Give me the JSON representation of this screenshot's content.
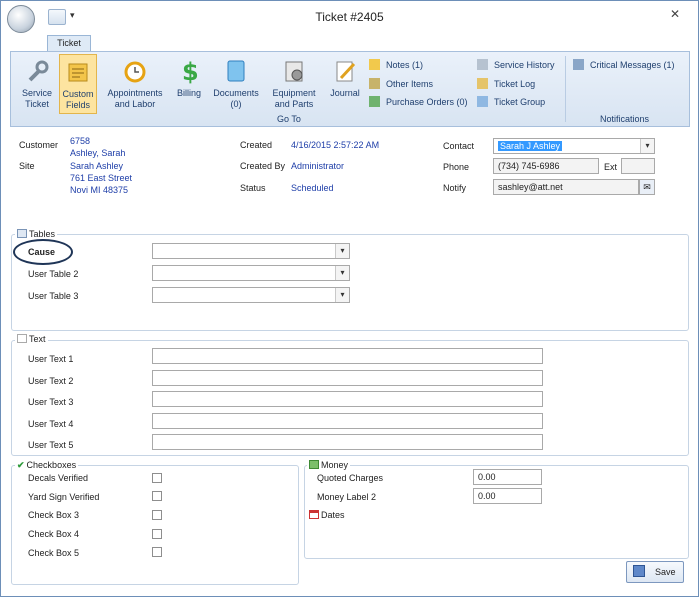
{
  "window": {
    "title": "Ticket #2405"
  },
  "tabs": [
    "Ticket"
  ],
  "ribbon": {
    "goto_buttons": [
      {
        "label1": "Service",
        "label2": "Ticket",
        "icon": "wrench-icon"
      },
      {
        "label1": "Custom",
        "label2": "Fields",
        "icon": "custom-fields-icon",
        "selected": true
      },
      {
        "label1": "Appointments",
        "label2": "and Labor",
        "icon": "alarm-clock-icon"
      },
      {
        "label1": "Billing",
        "label2": "",
        "icon": "dollar-icon"
      },
      {
        "label1": "Documents",
        "label2": "(0)",
        "icon": "document-icon"
      },
      {
        "label1": "Equipment",
        "label2": "and Parts",
        "icon": "equipment-icon"
      },
      {
        "label1": "Journal",
        "label2": "",
        "icon": "journal-icon"
      }
    ],
    "small_col1": [
      "Notes (1)",
      "Other Items",
      "Purchase Orders (0)"
    ],
    "small_col2": [
      "Service History",
      "Ticket Log",
      "Ticket Group"
    ],
    "goto_label": "Go To",
    "critical_messages": "Critical Messages (1)",
    "notifications_label": "Notifications"
  },
  "header": {
    "customer_label": "Customer",
    "customer_id": "6758",
    "customer_name": "Ashley, Sarah",
    "site_label": "Site",
    "site_name": "Sarah Ashley",
    "site_street": "761 East Street",
    "site_city": "Novi MI 48375",
    "created_label": "Created",
    "created_value": "4/16/2015 2:57:22 AM",
    "created_by_label": "Created By",
    "created_by_value": "Administrator",
    "status_label": "Status",
    "status_value": "Scheduled",
    "contact_label": "Contact",
    "contact_value": "Sarah J Ashley",
    "phone_label": "Phone",
    "phone_value": "(734) 745-6986",
    "ext_label": "Ext",
    "ext_value": "",
    "notify_label": "Notify",
    "notify_value": "sashley@att.net"
  },
  "tables": {
    "title": "Tables",
    "rows": [
      {
        "label": "Cause",
        "value": ""
      },
      {
        "label": "User Table 2",
        "value": ""
      },
      {
        "label": "User Table 3",
        "value": ""
      }
    ]
  },
  "text": {
    "title": "Text",
    "rows": [
      {
        "label": "User Text 1",
        "value": ""
      },
      {
        "label": "User Text 2",
        "value": ""
      },
      {
        "label": "User Text 3",
        "value": ""
      },
      {
        "label": "User Text 4",
        "value": ""
      },
      {
        "label": "User Text 5",
        "value": ""
      }
    ]
  },
  "checkboxes": {
    "title": "Checkboxes",
    "rows": [
      {
        "label": "Decals Verified",
        "checked": false
      },
      {
        "label": "Yard Sign Verified",
        "checked": false
      },
      {
        "label": "Check Box 3",
        "checked": false
      },
      {
        "label": "Check Box 4",
        "checked": false
      },
      {
        "label": "Check Box 5",
        "checked": false
      }
    ]
  },
  "money": {
    "title": "Money",
    "rows": [
      {
        "label": "Quoted Charges",
        "value": "0.00"
      },
      {
        "label": "Money Label 2",
        "value": "0.00"
      }
    ]
  },
  "dates": {
    "title": "Dates"
  },
  "save_label": "Save"
}
